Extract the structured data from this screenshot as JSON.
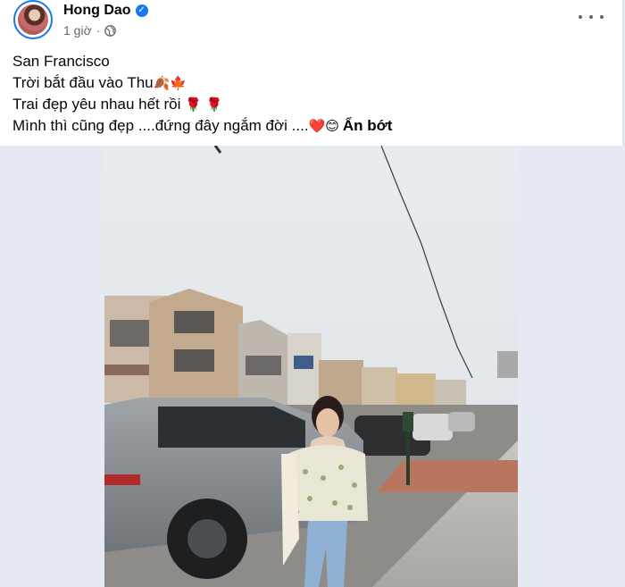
{
  "post": {
    "author_name": "Hong Dao",
    "time": "1 giờ",
    "separator": "·",
    "lines": [
      "San Francisco",
      "Trời bắt đầu vào Thu",
      "Trai đẹp yêu nhau hết rồi",
      "Mình thì cũng đẹp ....đứng đây ngắm đời ...."
    ],
    "line2_emoji": "🍂🍁",
    "line3_emoji": "🌹 🌹",
    "line4_emoji": "❤️😊",
    "see_less_label": "Ẩn bớt"
  },
  "icons": {
    "verified": "verified-badge-icon",
    "audience": "globe-icon",
    "more": "more-options-icon"
  },
  "colors": {
    "accent": "#1877f2",
    "text_primary": "#050505",
    "text_secondary": "#65676b",
    "background": "#e4e9f2"
  }
}
